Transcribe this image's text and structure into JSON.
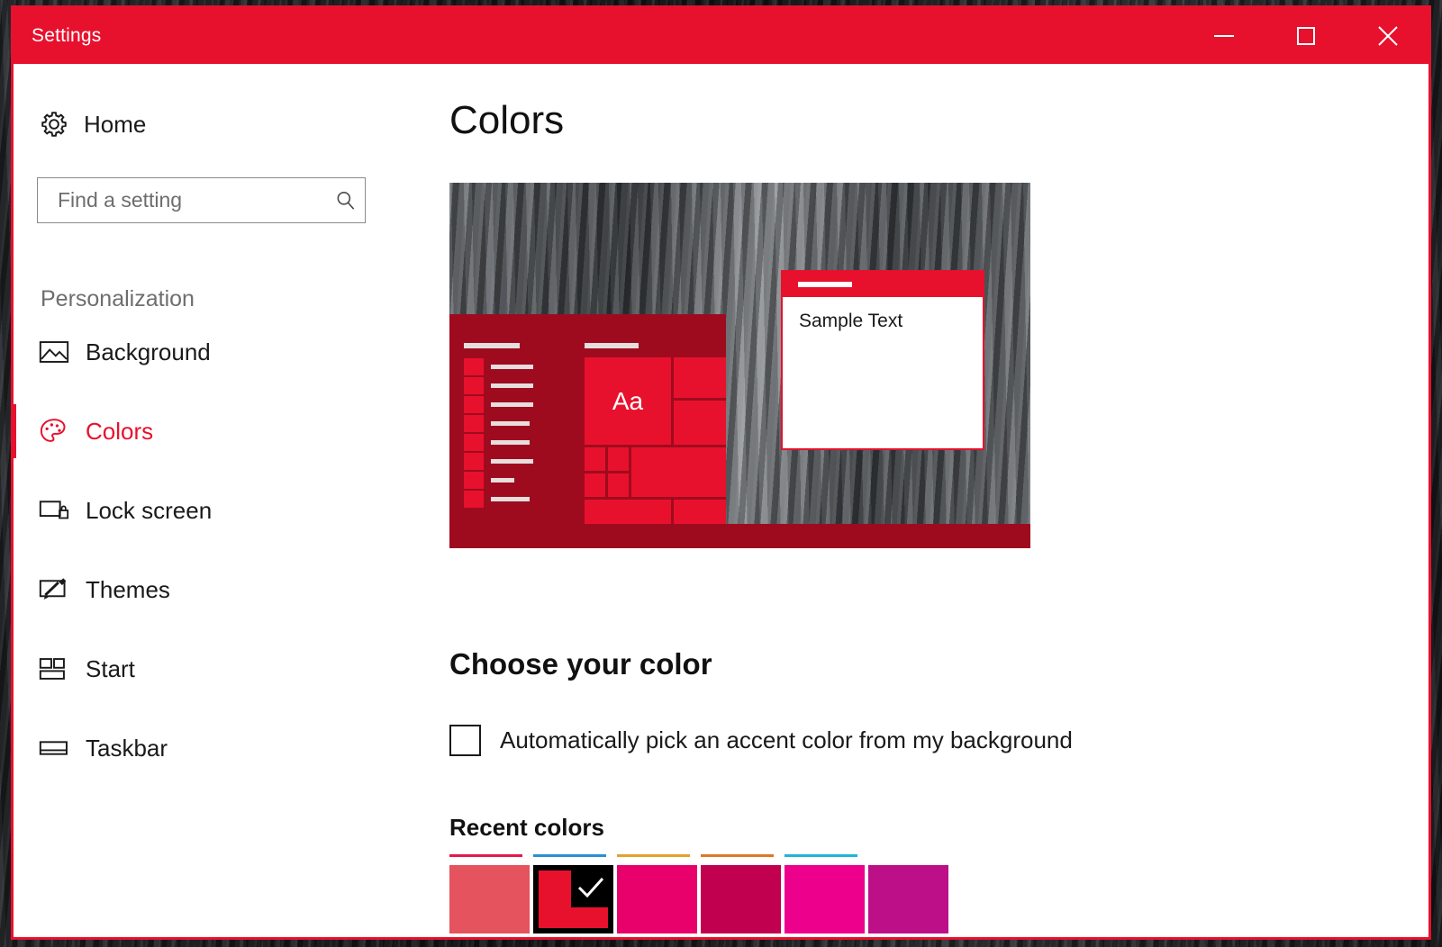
{
  "window": {
    "title": "Settings",
    "accent_color": "#e8112d",
    "caption_buttons": [
      {
        "name": "minimize",
        "glyph": "minimize-icon"
      },
      {
        "name": "maximize",
        "glyph": "maximize-icon"
      },
      {
        "name": "close",
        "glyph": "close-icon"
      }
    ]
  },
  "sidebar": {
    "home_label": "Home",
    "home_icon": "gear-icon",
    "search": {
      "placeholder": "Find a setting",
      "value": "",
      "icon": "search-icon"
    },
    "group_label": "Personalization",
    "items": [
      {
        "label": "Background",
        "icon": "picture-icon",
        "selected": false
      },
      {
        "label": "Colors",
        "icon": "palette-icon",
        "selected": true
      },
      {
        "label": "Lock screen",
        "icon": "lock-screen-icon",
        "selected": false
      },
      {
        "label": "Themes",
        "icon": "brush-icon",
        "selected": false
      },
      {
        "label": "Start",
        "icon": "start-tiles-icon",
        "selected": false
      },
      {
        "label": "Taskbar",
        "icon": "taskbar-icon",
        "selected": false
      }
    ]
  },
  "main": {
    "page_title": "Colors",
    "preview": {
      "start_accent": "#9e0b1e",
      "tile_color": "#e8112d",
      "tile_text": "Aa",
      "sample_window_text": "Sample Text"
    },
    "choose_your_color": {
      "heading": "Choose your color",
      "auto_accent": {
        "label": "Automatically pick an accent color from my background",
        "checked": false
      }
    },
    "recent_colors": {
      "heading": "Recent colors",
      "swatches": [
        {
          "color": "#e4535e",
          "underline": "#e4194a",
          "selected": false
        },
        {
          "color": "#e8112d",
          "underline": "#2a8fd4",
          "selected": true
        },
        {
          "color": "#e8006b",
          "underline": "#e0a32a",
          "selected": false
        },
        {
          "color": "#c10050",
          "underline": "#df7726",
          "selected": false
        },
        {
          "color": "#ec008c",
          "underline": "#1fb5d6",
          "selected": false
        },
        {
          "color": "#bd1088",
          "underline": "",
          "selected": false
        }
      ]
    }
  }
}
